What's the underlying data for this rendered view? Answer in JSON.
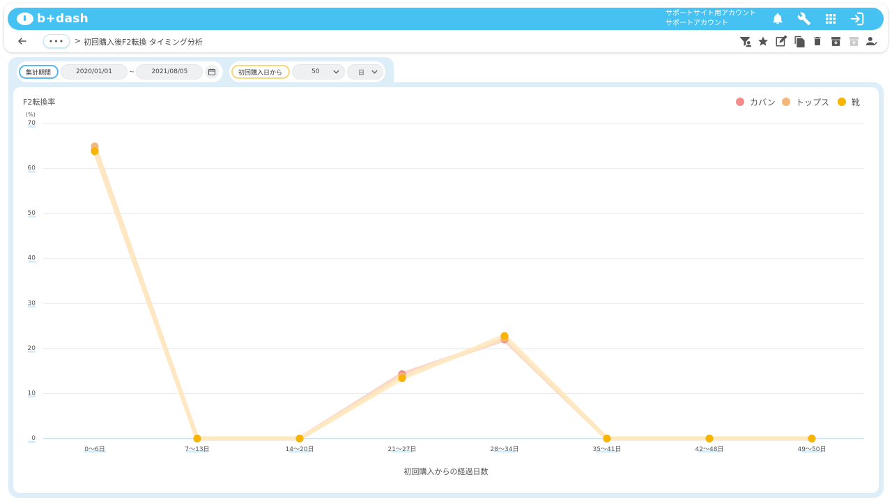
{
  "app": {
    "logo_text": "b+dash",
    "account_line1": "サポートサイト用アカウント",
    "account_line2": "サポートアカウント"
  },
  "icons": {
    "top": [
      "bell-icon",
      "wrench-icon",
      "apps-grid-icon",
      "logout-icon"
    ],
    "actions": [
      "filter-user-icon",
      "star-icon",
      "edit-icon",
      "copy-icon",
      "trash-icon",
      "archive-icon",
      "unarchive-icon",
      "user-check-icon"
    ]
  },
  "breadcrumb": {
    "more_label": "•••",
    "separator": ">",
    "title": "初回購入後F2転換 タイミング分析"
  },
  "filters": {
    "period_label": "集計期間",
    "start_date": "2020/01/01",
    "tilde": "~",
    "end_date": "2021/08/05",
    "from_label": "初回購入日から",
    "count_value": "50",
    "unit_value": "日"
  },
  "colors": {
    "brand": "#45c1f2",
    "kaban": "#f28c8c",
    "tops": "#f5b67c",
    "kutsu": "#f7b500"
  },
  "chart_data": {
    "type": "line",
    "title": "F2転換率",
    "unit": "(%)",
    "xlabel": "初回購入からの経過日数",
    "categories": [
      "0〜6日",
      "7〜13日",
      "14〜20日",
      "21〜27日",
      "28〜34日",
      "35〜41日",
      "42〜48日",
      "49〜50日"
    ],
    "ylim": [
      0,
      70
    ],
    "yticks": [
      0,
      10,
      20,
      30,
      40,
      50,
      60,
      70
    ],
    "legend_position": "top-right",
    "grid": true,
    "series": [
      {
        "name": "カバン",
        "color": "#f28c8c",
        "values": [
          64.0,
          0,
          0,
          14.3,
          22.0,
          0,
          0,
          0
        ]
      },
      {
        "name": "トップス",
        "color": "#f5b67c",
        "values": [
          64.9,
          0,
          0,
          13.8,
          22.3,
          0,
          0,
          0
        ]
      },
      {
        "name": "靴",
        "color": "#f7b500",
        "values": [
          63.8,
          0,
          0,
          13.4,
          22.8,
          0,
          0,
          0
        ]
      }
    ]
  }
}
